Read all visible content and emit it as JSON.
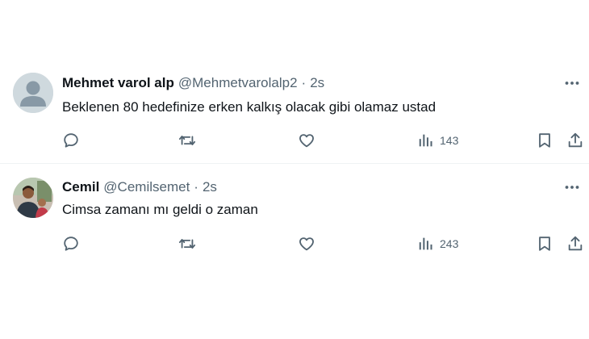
{
  "colors": {
    "text_primary": "#0f1419",
    "text_secondary": "#536471",
    "divider": "#eff3f4",
    "background": "#ffffff"
  },
  "tweets": [
    {
      "display_name": "Mehmet varol alp",
      "handle": "@Mehmetvarolalp2",
      "separator": "·",
      "time": "2s",
      "text": "Beklenen 80 hedefinize erken kalkış olacak gibi olamaz ustad",
      "views": "143",
      "avatar_icon": "default-avatar-icon"
    },
    {
      "display_name": "Cemil",
      "handle": "@Cemilsemet",
      "separator": "·",
      "time": "2s",
      "text": "Cimsa zamanı mı geldi o zaman",
      "views": "243",
      "avatar_icon": "profile-photo"
    }
  ]
}
